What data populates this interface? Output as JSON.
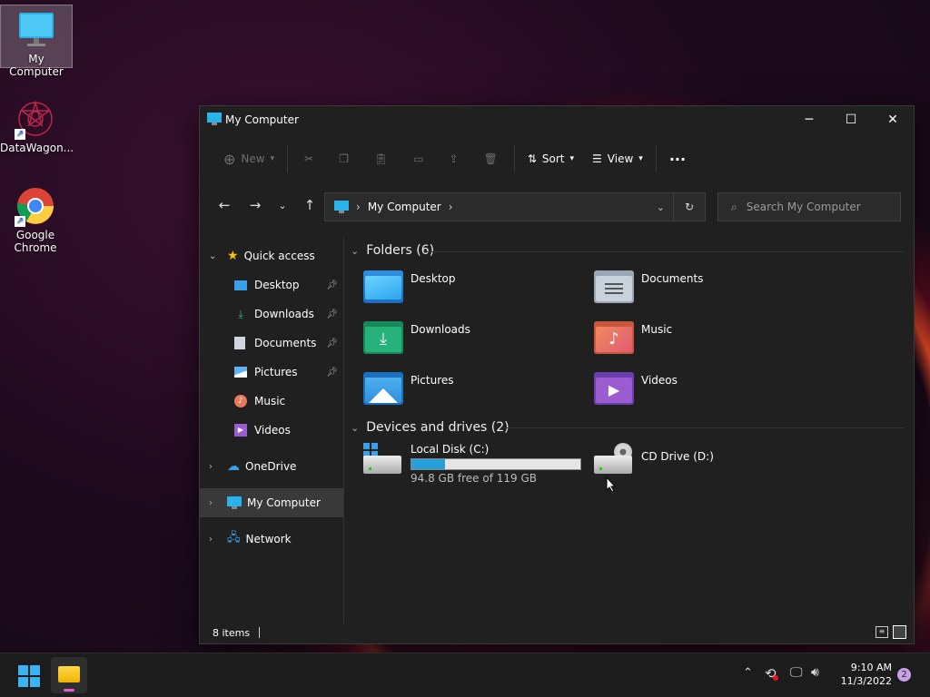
{
  "desktop": {
    "icons": [
      {
        "label": "My Computer",
        "icon": "monitor-icon"
      },
      {
        "label": "DataWagon...",
        "icon": "datawagon-icon"
      },
      {
        "label": "Google Chrome",
        "icon": "chrome-icon"
      }
    ]
  },
  "window": {
    "title": "My Computer",
    "toolbar": {
      "new_label": "New",
      "sort_label": "Sort",
      "view_label": "View"
    },
    "address": {
      "location": "My Computer"
    },
    "search": {
      "placeholder": "Search My Computer"
    },
    "sidebar": {
      "quick_access": "Quick access",
      "items": [
        {
          "label": "Desktop",
          "pinned": true
        },
        {
          "label": "Downloads",
          "pinned": true
        },
        {
          "label": "Documents",
          "pinned": true
        },
        {
          "label": "Pictures",
          "pinned": true
        },
        {
          "label": "Music",
          "pinned": false
        },
        {
          "label": "Videos",
          "pinned": false
        }
      ],
      "onedrive": "OneDrive",
      "my_computer": "My Computer",
      "network": "Network"
    },
    "folders_header": "Folders (6)",
    "folders": [
      {
        "label": "Desktop"
      },
      {
        "label": "Documents"
      },
      {
        "label": "Downloads"
      },
      {
        "label": "Music"
      },
      {
        "label": "Pictures"
      },
      {
        "label": "Videos"
      }
    ],
    "drives_header": "Devices and drives (2)",
    "drives": {
      "c": {
        "label": "Local Disk (C:)",
        "free_text": "94.8 GB free of 119 GB",
        "used_fraction": 0.2
      },
      "d": {
        "label": "CD Drive (D:)"
      }
    },
    "status": {
      "items": "8 items"
    }
  },
  "taskbar": {
    "time": "9:10 AM",
    "date": "11/3/2022",
    "notification_count": "2"
  },
  "colors": {
    "accent": "#3aa0e8",
    "window_bg": "#202020",
    "taskbar_bg": "#1c1c1c"
  }
}
